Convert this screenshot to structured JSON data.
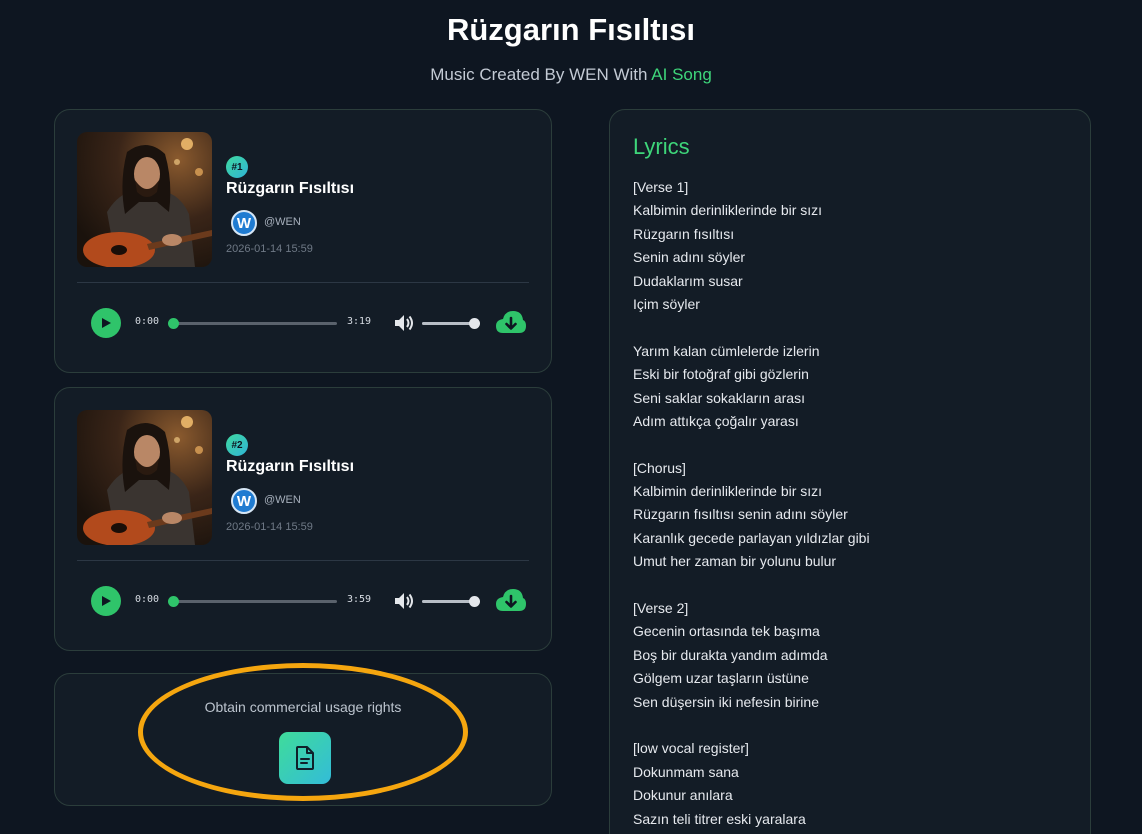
{
  "header": {
    "title": "Rüzgarın Fısıltısı",
    "subtitle_prefix": "Music Created By WEN With ",
    "subtitle_link": "AI Song"
  },
  "songs": [
    {
      "rank": "#1",
      "title": "Rüzgarın Fısıltısı",
      "avatar_letter": "W",
      "handle": "@WEN",
      "date": "2026-01-14 15:59",
      "time_current": "0:00",
      "time_total": "3:19",
      "progress": 0,
      "volume": 1.0
    },
    {
      "rank": "#2",
      "title": "Rüzgarın Fısıltısı",
      "avatar_letter": "W",
      "handle": "@WEN",
      "date": "2026-01-14 15:59",
      "time_current": "0:00",
      "time_total": "3:59",
      "progress": 0,
      "volume": 1.0
    }
  ],
  "rights": {
    "label": "Obtain commercial usage rights",
    "icon": "document-icon"
  },
  "lyrics": {
    "heading": "Lyrics",
    "lines": [
      "[Verse 1]",
      "Kalbimin derinliklerinde bir sızı",
      "Rüzgarın fısıltısı",
      "Senin adını söyler",
      "Dudaklarım susar",
      "Içim söyler",
      "",
      "Yarım kalan cümlelerde izlerin",
      "Eski bir fotoğraf gibi gözlerin",
      "Seni saklar sokakların arası",
      "Adım attıkça çoğalır yarası",
      "",
      "[Chorus]",
      "Kalbimin derinliklerinde bir sızı",
      "Rüzgarın fısıltısı senin adını söyler",
      "Karanlık gecede parlayan yıldızlar gibi",
      "Umut her zaman bir yolunu bulur",
      "",
      "[Verse 2]",
      "Gecenin ortasında tek başıma",
      "Boş bir durakta yandım adımda",
      "Gölgem uzar taşların üstüne",
      "Sen düşersin iki nefesin birine",
      "",
      "[low vocal register]",
      "Dokunmam sana",
      "Dokunur anılara",
      "Sazın teli titrer eski yaralara"
    ]
  },
  "colors": {
    "background": "#0e1621",
    "accent_green": "#3ed67a",
    "highlight_orange": "#f5a60f"
  }
}
